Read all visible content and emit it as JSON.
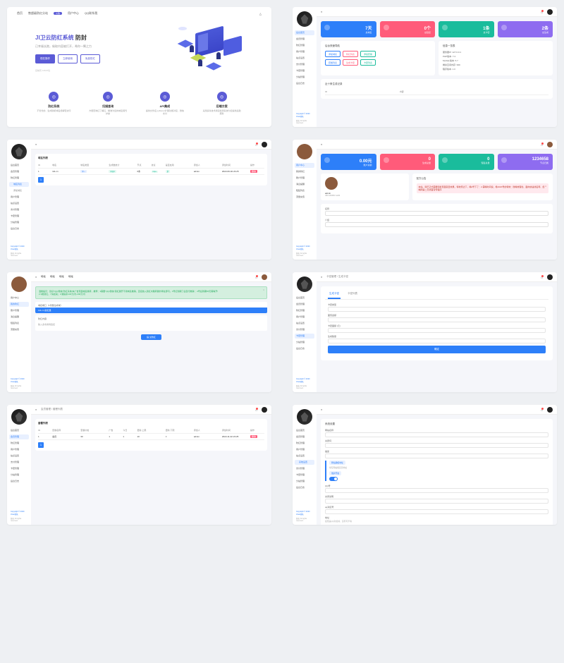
{
  "colors": {
    "primary": "#5b5bd6",
    "blue": "#2d7ff9",
    "red": "#ff5b7a",
    "teal": "#1abc9c",
    "purple": "#8e6cf0"
  },
  "footer": {
    "copy": "Copyright © 2020 JIwei团队",
    "rights": "版权 All rights reserved."
  },
  "s1": {
    "nav": [
      "首页",
      "售超级防红分站",
      "用户中心",
      "QQ联系我"
    ],
    "nav_badge": "火热",
    "title_accent": "JI卫云防红系统",
    "title_rest": " 防封",
    "subtitle": "已幸福长跑，偷取内容被打开，希你一臂之力",
    "buttons": [
      "现在操作",
      "立即使用",
      "免费防红"
    ],
    "caption": "目前有 13537位",
    "features": [
      {
        "icon": "◎",
        "title": "防红系统",
        "desc": "不管长的、生成随机域名终解轻访问"
      },
      {
        "icon": "◎",
        "title": "扫描查询",
        "desc": "方便查询红了解红、精准为您的域名保驾护航"
      },
      {
        "icon": "◎",
        "title": "API集成",
        "desc": "提供文件接入Discuz扩展功能对接、微信支付"
      },
      {
        "icon": "◎",
        "title": "后端方案",
        "desc": "采用多条技术通道检测系统为您提供后勤服务"
      }
    ]
  },
  "s2": {
    "menu": [
      "后台首页",
      "会员管理",
      "防红管理",
      "用户管理",
      "站点设置",
      "支付管理",
      "卡密管理",
      "分站管理",
      "后台日志"
    ],
    "cards": [
      {
        "n": "7天",
        "l": "总域名"
      },
      {
        "n": "0个",
        "l": "总链接"
      },
      {
        "n": "1条",
        "l": "总卡密"
      },
      {
        "n": "2条",
        "l": "总生成"
      }
    ],
    "quick_title": "后台快速导航",
    "quick": [
      [
        "添加域名",
        "b"
      ],
      [
        "防红列表",
        "r"
      ],
      [
        "添加套餐",
        "g"
      ],
      [
        "套餐列表",
        "b"
      ],
      [
        "生成卡密",
        "r"
      ],
      [
        "卡密列表",
        "g"
      ]
    ],
    "info_title": "信息一览表",
    "info": [
      "服务器IP: 127.0.0.1",
      "PHP版本: 7.4",
      "MySQL版本: 5.7",
      "剩余空间内存: 999",
      "程序版本: 1.0"
    ],
    "recent_title": "近十条生成记录",
    "recent_cols": [
      "ID",
      "内容"
    ]
  },
  "s3": {
    "menu": [
      "后台首页",
      "会员管理",
      "防红管理",
      "域名列表",
      "添加域名",
      "用户管理",
      "站点设置",
      "支付管理",
      "卡密管理",
      "分站管理",
      "后台日志"
    ],
    "active": "域名列表",
    "title": "域名列表",
    "cols": [
      "ID",
      "域名",
      "域名类型",
      "生成数统计",
      "节点",
      "协议",
      "是否启用",
      "添加人",
      "添加时间",
      "操作"
    ],
    "row": [
      "1",
      "111.cn",
      "单一",
      "中国1",
      "0条",
      "https",
      "是",
      "admin",
      "2022-09-02 23:25",
      "删除"
    ],
    "page": "1"
  },
  "s4": {
    "menu": [
      "用户中心",
      "我的防红",
      "账户管理",
      "消息提醒",
      "短链列表",
      "流量充值"
    ],
    "cards": [
      {
        "n": "0.00元",
        "l": "账户余额"
      },
      {
        "n": "0",
        "l": "生成总量"
      },
      {
        "n": "0",
        "l": "短链总量"
      },
      {
        "n": "1234658",
        "l": "节点归属"
      }
    ],
    "user": {
      "name": "admin",
      "id": "UID 1234567-1240"
    },
    "notice_title": "官方公告",
    "notice": "本站、除已正式需要和新页面突显效果，特地传达下，嘴2号下了：2.需嘴时间说，希2020号的特效：微嘴效理化、面向快速线名称、经嘴网第二天线首营传程序"
  },
  "s5": {
    "menu": [
      "用户中心",
      "我的防红",
      "账户管理",
      "消息提醒",
      "短链列表",
      "流量充值"
    ],
    "tabs": [
      "地址",
      "地址",
      "地址",
      "地址"
    ],
    "notice": "温馨提示：您好\"QQ/微信\"防红系统/本广告页面域名跳转，推荐：3需要\"QQ/微信\"别红展开不用域名推销，直接放入别红内跳转展外网址即可。1号红到期了后自行推销:：2号后到期65天需等开!",
    "notice2": "2.3类别红，7请如来；3.跳提条130元/月-200元/月",
    "group1_label": "域名端口（1则量生成域）",
    "group1_value": "111.cn-别红量",
    "group2_label": "防红内容",
    "group2_hint": "输入多条换码链接",
    "submit": "提 交防红"
  },
  "s6": {
    "menu": [
      "后台首页",
      "会员管理",
      "防红管理",
      "用户管理",
      "站点设置",
      "支付管理",
      "卡密管理",
      "分站管理",
      "后台日志"
    ],
    "crumb": "卡密管理 / 生成卡密",
    "tabs": [
      "生成卡密",
      "卡密列表"
    ],
    "fields": [
      {
        "label": "卡密类型"
      },
      {
        "label": "面值金额"
      },
      {
        "label": "卡密面额 (元)"
      },
      {
        "label": "生成数量"
      }
    ],
    "submit": "确定"
  },
  "s7": {
    "menu": [
      "后台首页",
      "会员管理",
      "防红管理",
      "用户管理",
      "站点设置",
      "支付管理",
      "卡密管理",
      "分站管理",
      "后台日志"
    ],
    "crumb": "会员管理 / 套餐列表",
    "title": "套餐列表",
    "cols": [
      "ID",
      "套餐名称",
      "套餐价格",
      "广告",
      "今日",
      "更新-上限",
      "更新-下限",
      "添加人",
      "添加时间",
      "操作"
    ],
    "row": [
      "1",
      "会员",
      "30",
      "1",
      "1",
      "10",
      "0",
      "admin",
      "2022-11-02 23:25",
      "删除"
    ],
    "page": "1"
  },
  "s8": {
    "menu": [
      "后台首页",
      "会员管理",
      "防红管理",
      "用户管理",
      "站点设置",
      "系统设置",
      "支付管理",
      "卡密管理",
      "分站管理",
      "后台日志"
    ],
    "active": "系统设置",
    "title": "系统设置",
    "fields": [
      {
        "label": "网站名称"
      },
      {
        "label": "关键词"
      },
      {
        "label": "描述"
      },
      {
        "label": "网站确权地址",
        "chip": "网站确权地址",
        "hint": "填写网站根目录地址"
      },
      {
        "label": "维护时间",
        "chip": "维护开启"
      },
      {
        "label": "QQ号"
      },
      {
        "label": "关闭说明"
      },
      {
        "label": "qq对接号"
      },
      {
        "label": "地址",
        "hint": "如果是QQ对接填，没有可不填"
      }
    ],
    "ok": "确定"
  }
}
